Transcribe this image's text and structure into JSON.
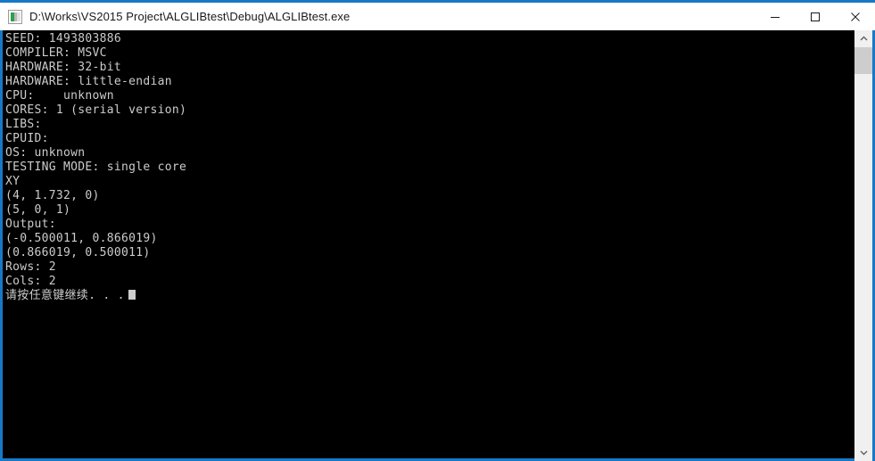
{
  "window": {
    "title": "D:\\Works\\VS2015 Project\\ALGLIBtest\\Debug\\ALGLIBtest.exe",
    "icon": "console-app-icon",
    "border_color": "#1878c8",
    "titlebar_bg": "#ffffff",
    "console_bg": "#000000",
    "console_fg": "#cccccc"
  },
  "window_controls": {
    "minimize_label": "Minimize",
    "maximize_label": "Maximize",
    "close_label": "Close"
  },
  "console": {
    "lines": [
      "SEED: 1493803886",
      "COMPILER: MSVC",
      "HARDWARE: 32-bit",
      "HARDWARE: little-endian",
      "CPU:    unknown",
      "CORES: 1 (serial version)",
      "LIBS:",
      "CPUID:",
      "OS: unknown",
      "TESTING MODE: single core",
      "XY",
      "(4, 1.732, 0)",
      "(5, 0, 1)",
      "Output:",
      "(-0.500011, 0.866019)",
      "(0.866019, 0.500011)",
      "Rows: 2",
      "Cols: 2"
    ],
    "prompt_line": "请按任意键继续. . .",
    "cursor": "block-cursor"
  },
  "scrollbar": {
    "up_arrow": "chevron-up-icon",
    "down_arrow": "chevron-down-icon",
    "thumb_color": "#cdcdcd",
    "track_color": "#f0f0f0"
  }
}
